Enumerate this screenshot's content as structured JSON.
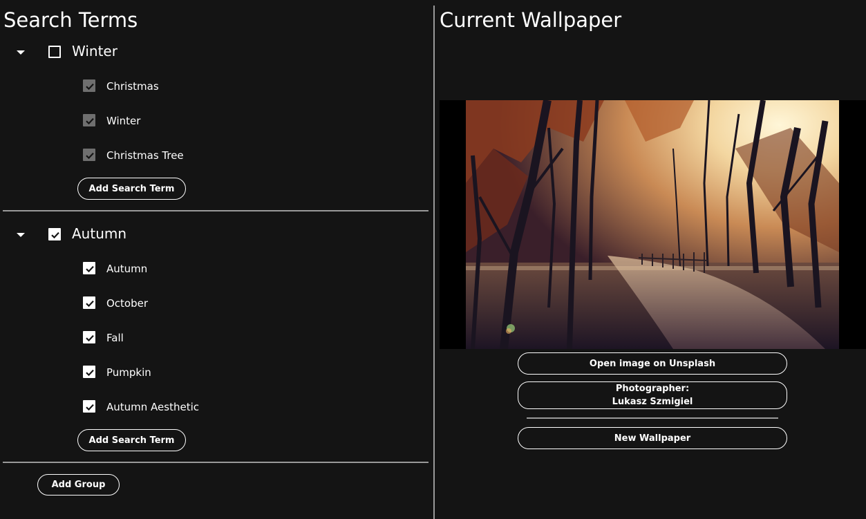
{
  "left": {
    "title": "Search Terms",
    "groups": [
      {
        "label": "Winter",
        "checked": false,
        "terms": [
          {
            "label": "Christmas",
            "checked": true
          },
          {
            "label": "Winter",
            "checked": true
          },
          {
            "label": "Christmas Tree",
            "checked": true
          }
        ],
        "add_term_label": "Add Search Term"
      },
      {
        "label": "Autumn",
        "checked": true,
        "terms": [
          {
            "label": "Autumn",
            "checked": true
          },
          {
            "label": "October",
            "checked": true
          },
          {
            "label": "Fall",
            "checked": true
          },
          {
            "label": "Pumpkin",
            "checked": true
          },
          {
            "label": "Autumn Aesthetic",
            "checked": true
          }
        ],
        "add_term_label": "Add Search Term"
      }
    ],
    "add_group_label": "Add Group"
  },
  "right": {
    "title": "Current Wallpaper",
    "open_unsplash_label": "Open image on Unsplash",
    "photographer_label": "Photographer:",
    "photographer_name": "Lukasz Szmigiel",
    "new_wallpaper_label": "New Wallpaper"
  },
  "icons": {
    "expander": "caret-down-icon",
    "checkbox": "checkmark-icon"
  },
  "colors": {
    "background": "#141414",
    "divider": "#9a9a9a",
    "checkbox_disabled": "#6f6f6f"
  }
}
